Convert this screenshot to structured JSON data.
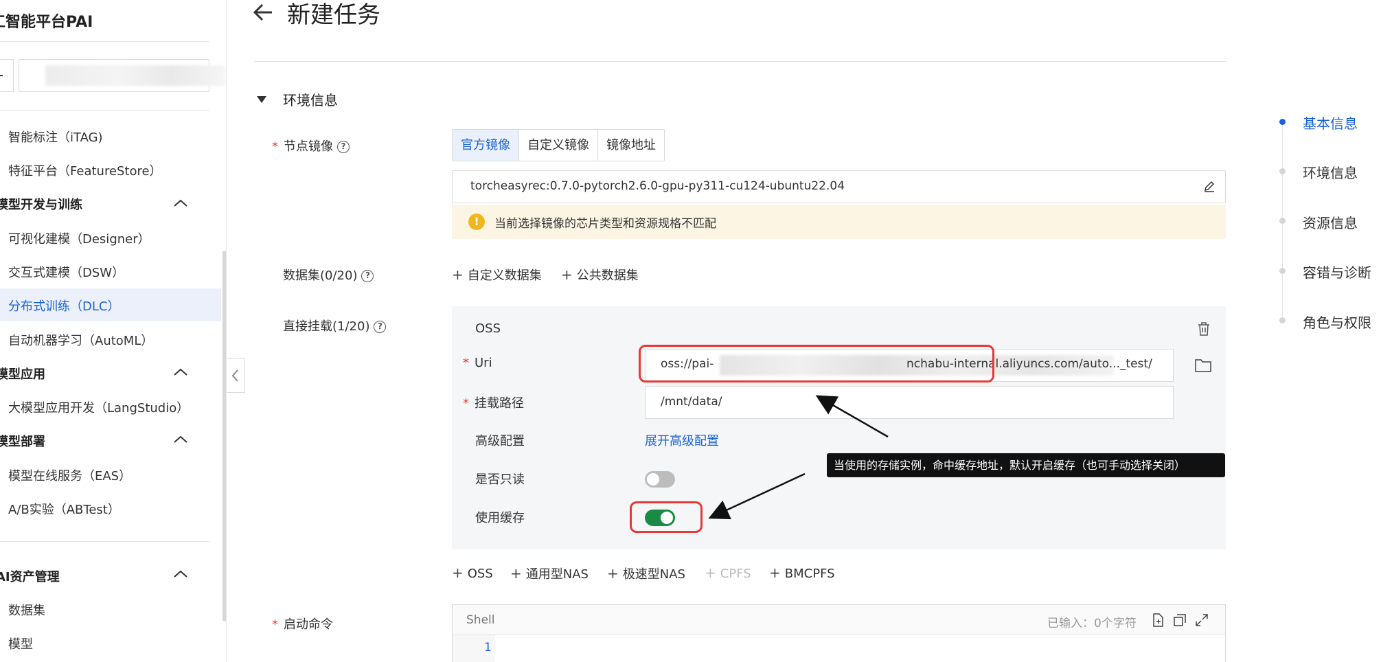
{
  "sidebar": {
    "brand": "工智能平台PAI",
    "items": [
      {
        "label": "智能标注（iTAG)"
      },
      {
        "label": "特征平台（FeatureStore）"
      },
      {
        "label": "模型开发与训练",
        "group": true
      },
      {
        "label": "可视化建模（Designer）"
      },
      {
        "label": "交互式建模（DSW）"
      },
      {
        "label": "分布式训练（DLC）",
        "active": true
      },
      {
        "label": "自动机器学习（AutoML）"
      },
      {
        "label": "模型应用",
        "group": true
      },
      {
        "label": "大模型应用开发（LangStudio）"
      },
      {
        "label": "模型部署",
        "group": true
      },
      {
        "label": "模型在线服务（EAS）"
      },
      {
        "label": "A/B实验（ABTest）"
      },
      {
        "label": "AI资产管理",
        "group": true
      },
      {
        "label": "数据集"
      },
      {
        "label": "模型"
      }
    ]
  },
  "header": {
    "title": "新建任务"
  },
  "section": {
    "title": "环境信息"
  },
  "node_image": {
    "label": "节点镜像",
    "tabs": [
      "官方镜像",
      "自定义镜像",
      "镜像地址"
    ],
    "selected_tab": "官方镜像",
    "value": "torcheasyrec:0.7.0-pytorch2.6.0-gpu-py311-cu124-ubuntu22.04",
    "warning": "当前选择镜像的芯片类型和资源规格不匹配"
  },
  "dataset": {
    "label": "数据集(0/20)",
    "add_custom": "自定义数据集",
    "add_public": "公共数据集"
  },
  "mount": {
    "label": "直接挂载(1/20)",
    "type": "OSS",
    "uri_label": "Uri",
    "uri_prefix": "oss://pai-",
    "uri_suffix": "nchabu-internal.aliyuncs.com/auto..._test/",
    "path_label": "挂载路径",
    "path_value": "/mnt/data/",
    "advanced_label": "高级配置",
    "advanced_link": "展开高级配置",
    "readonly_label": "是否只读",
    "readonly": false,
    "cache_label": "使用缓存",
    "cache": true,
    "add_buttons": [
      "OSS",
      "通用型NAS",
      "极速型NAS",
      "CPFS",
      "BMCPFS"
    ],
    "disabled_button": "CPFS"
  },
  "annotation": {
    "text": "当使用的存储实例，命中缓存地址，默认开启缓存（也可手动选择关闭）"
  },
  "command": {
    "label": "启动命令",
    "lang": "Shell",
    "count": "已输入：0个字符",
    "line": "1"
  },
  "steps": [
    {
      "label": "基本信息",
      "active": true
    },
    {
      "label": "环境信息"
    },
    {
      "label": "资源信息"
    },
    {
      "label": "容错与诊断"
    },
    {
      "label": "角色与权限"
    }
  ],
  "colors": {
    "accent": "#1a62d6",
    "toggle_on": "#1b8a45",
    "warning_bg": "#fdf5e4",
    "highlight": "#e53935"
  }
}
